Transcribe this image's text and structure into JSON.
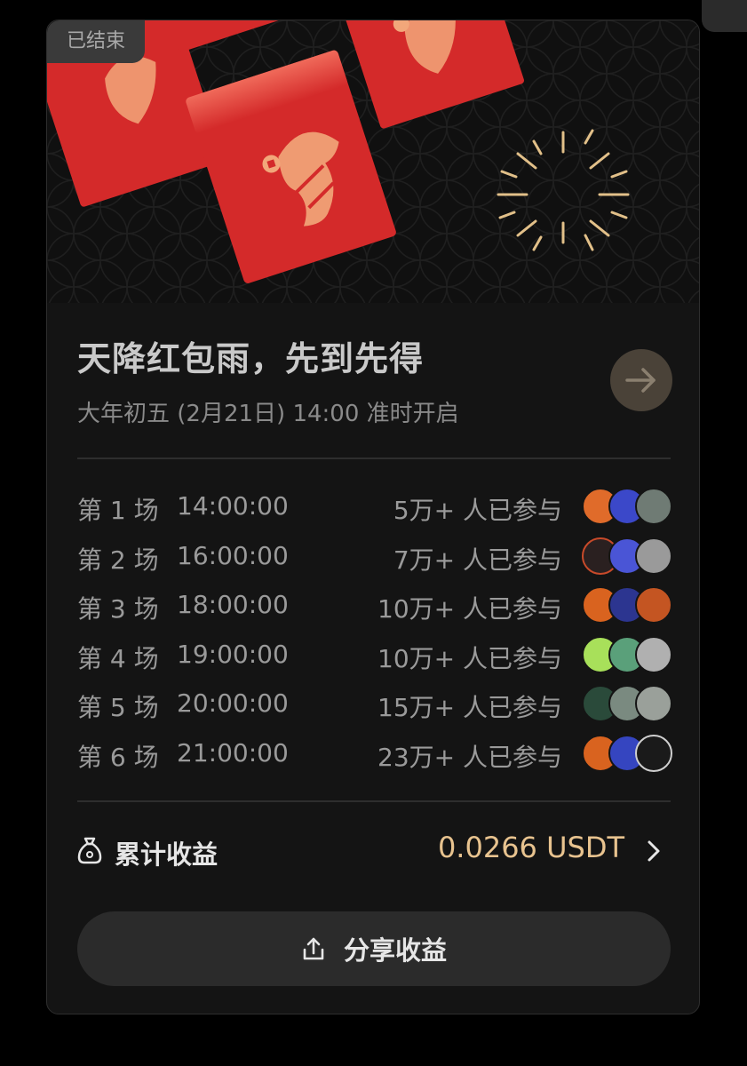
{
  "badge": "已结束",
  "title": "天降红包雨，先到先得",
  "subtitle": "大年初五 (2月21日) 14:00 准时开启",
  "rounds": [
    {
      "label": "第 1 场",
      "time": "14:00:00",
      "count": "5万+ 人已参与"
    },
    {
      "label": "第 2 场",
      "time": "16:00:00",
      "count": "7万+ 人已参与"
    },
    {
      "label": "第 3 场",
      "time": "18:00:00",
      "count": "10万+ 人已参与"
    },
    {
      "label": "第 4 场",
      "time": "19:00:00",
      "count": "10万+ 人已参与"
    },
    {
      "label": "第 5 场",
      "time": "20:00:00",
      "count": "15万+ 人已参与"
    },
    {
      "label": "第 6 场",
      "time": "21:00:00",
      "count": "23万+ 人已参与"
    }
  ],
  "earnings": {
    "label": "累计收益",
    "value": "0.0266 USDT"
  },
  "share": {
    "label": "分享收益"
  },
  "colors": {
    "accent": "#e8c38f",
    "envelope": "#d42a2a",
    "arrow_button": "#4a4238"
  },
  "icons": {
    "arrow": "arrow-right-icon",
    "money_bag": "money-bag-icon",
    "chevron": "chevron-right-icon",
    "share": "share-icon"
  }
}
